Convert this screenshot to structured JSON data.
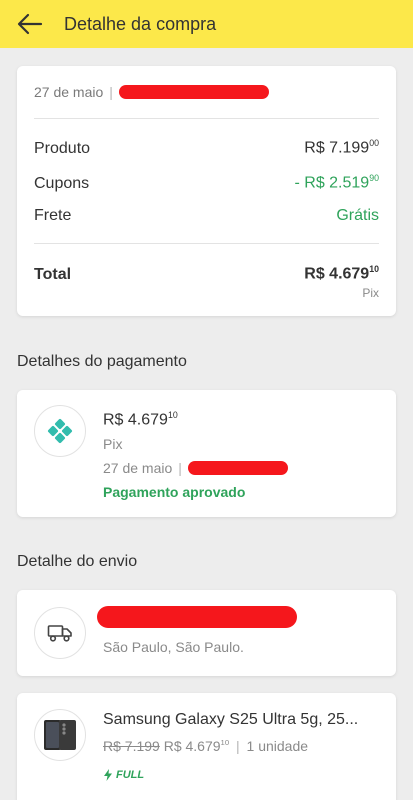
{
  "header": {
    "title": "Detalhe da compra"
  },
  "summary": {
    "date": "27 de maio",
    "separator": "|",
    "rows": [
      {
        "label": "Produto",
        "value_main": "R$ 7.199",
        "value_cents": "00",
        "tone": "default"
      },
      {
        "label": "Cupons",
        "value_main": "- R$ 2.519",
        "value_cents": "90",
        "tone": "green"
      },
      {
        "label": "Frete",
        "value_main": "Grátis",
        "value_cents": "",
        "tone": "green"
      }
    ],
    "total": {
      "label": "Total",
      "value_main": "R$ 4.679",
      "value_cents": "10",
      "method": "Pix"
    }
  },
  "payment": {
    "section_title": "Detalhes do pagamento",
    "amount_main": "R$ 4.679",
    "amount_cents": "10",
    "method": "Pix",
    "date": "27 de maio",
    "separator": "|",
    "status": "Pagamento aprovado",
    "icon": "pix-icon"
  },
  "shipping": {
    "section_title": "Detalhe do envio",
    "city": "São Paulo, São Paulo.",
    "icon": "truck-icon"
  },
  "item": {
    "title": "Samsung Galaxy S25 Ultra 5g, 25...",
    "old_price": "R$ 7.199",
    "price_main": "R$ 4.679",
    "price_cents": "10",
    "separator": "|",
    "quantity": "1 unidade",
    "badge": "FULL"
  },
  "colors": {
    "header": "#fce84a",
    "green": "#2fa35b",
    "pix": "#32bcad",
    "redaction": "#f5171c"
  }
}
